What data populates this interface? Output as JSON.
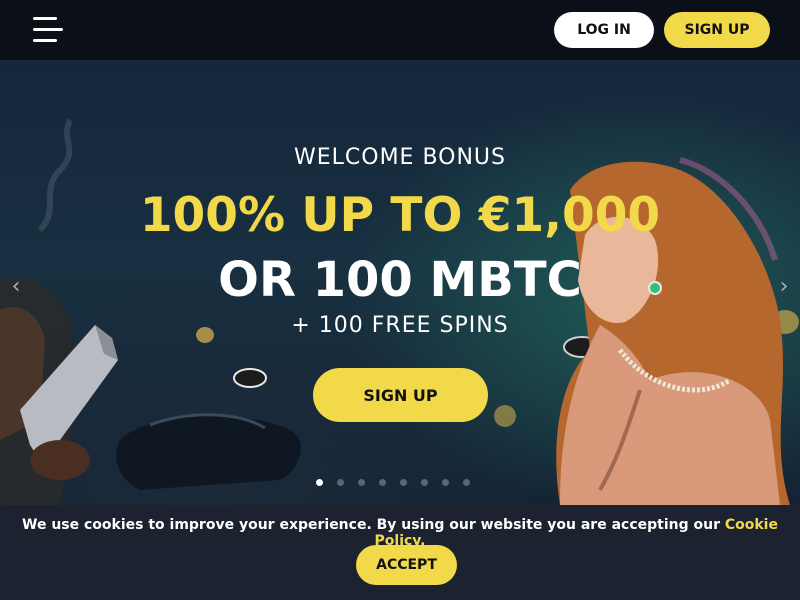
{
  "header": {
    "menu_icon": "hamburger-menu-icon",
    "login_label": "LOG IN",
    "signup_label": "SIGN UP"
  },
  "hero": {
    "welcome": "WELCOME BONUS",
    "headline": "100% UP TO €1,000",
    "subline": "OR 100 MBTC",
    "spins": "+ 100 FREE SPINS",
    "signup_label": "SIGN UP",
    "prev_icon": "chevron-left-icon",
    "next_icon": "chevron-right-icon",
    "slide_count": 8,
    "active_slide": 1
  },
  "cookie": {
    "text": "We use cookies to improve your experience. By using our website you are accepting our ",
    "link": "Cookie Policy.",
    "accept_label": "ACCEPT"
  },
  "colors": {
    "accent": "#f2d94a",
    "topbar": "#0b0f17",
    "cookie_bg": "#1d2230"
  }
}
